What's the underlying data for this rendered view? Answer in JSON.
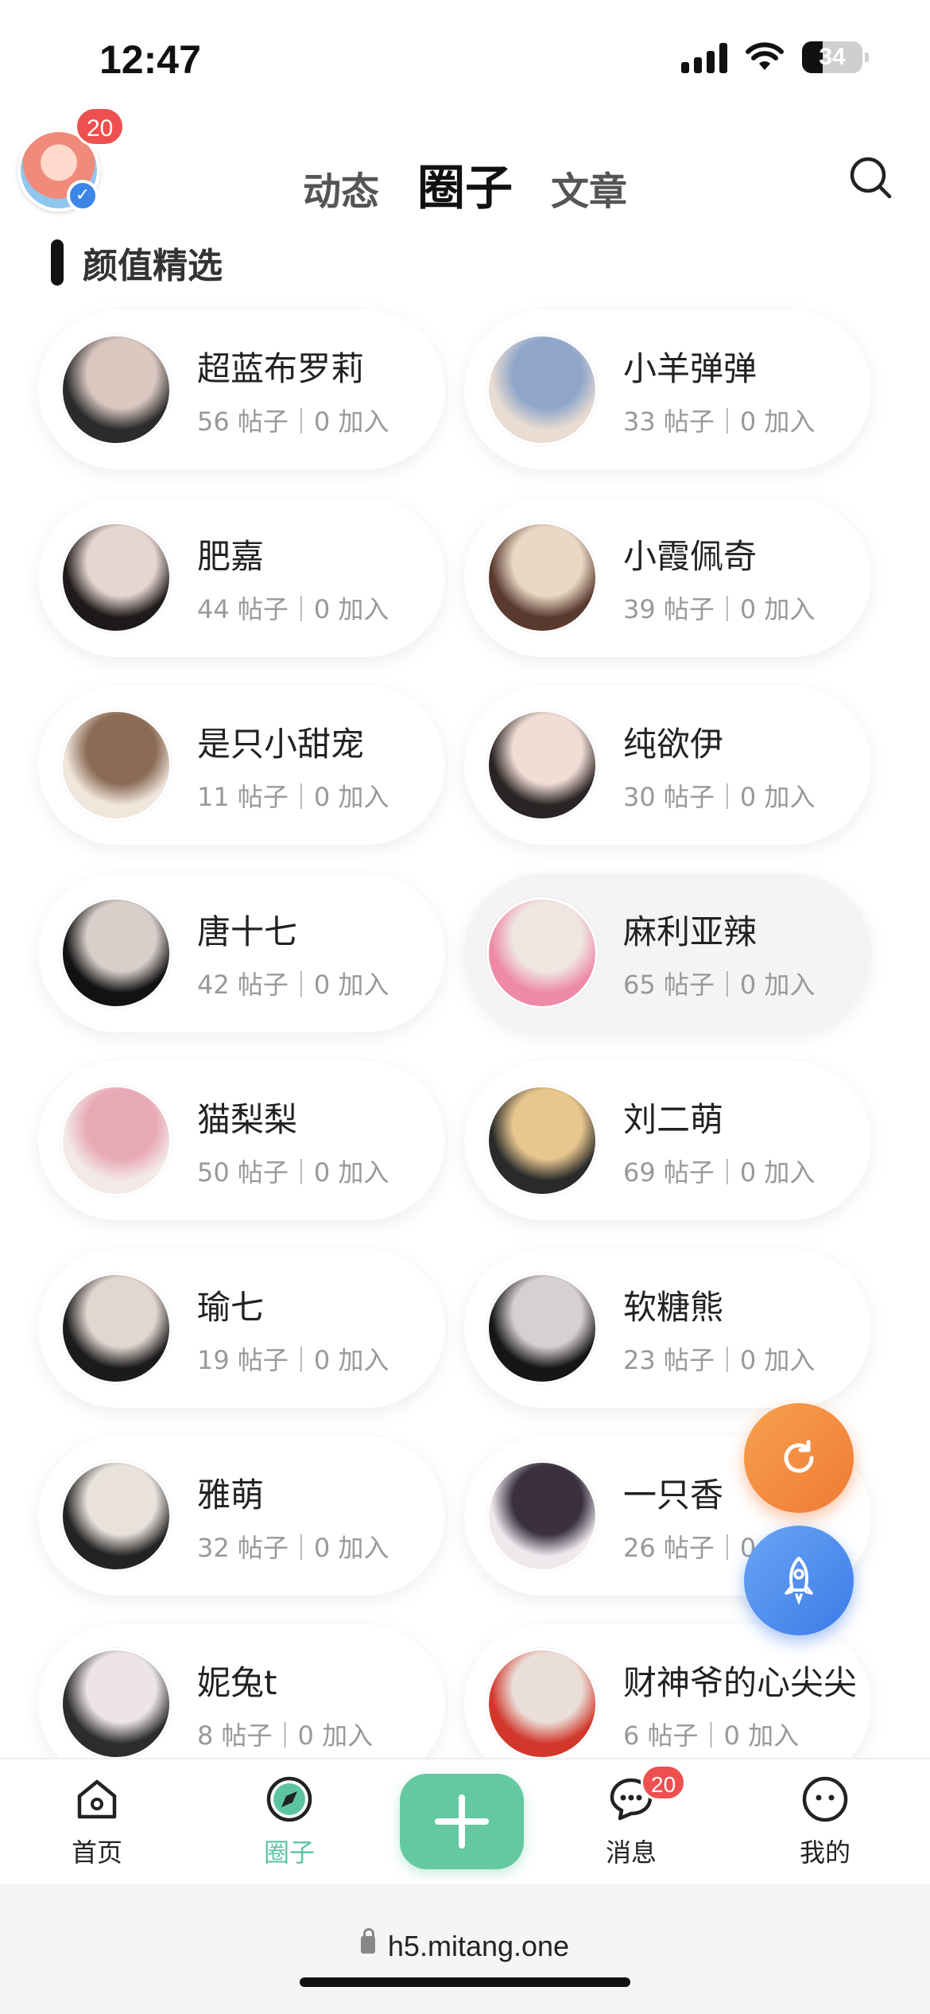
{
  "status_bar": {
    "time": "12:47",
    "battery": "34"
  },
  "header": {
    "notification_count": "20",
    "tabs": [
      {
        "label": "动态",
        "active": false
      },
      {
        "label": "圈子",
        "active": true
      },
      {
        "label": "文章",
        "active": false
      }
    ]
  },
  "section": {
    "title": "颜值精选"
  },
  "circles": [
    {
      "name": "超蓝布罗莉",
      "meta": "56 帖子｜0 加入",
      "colors": [
        "#2b2b2b",
        "#d9c7c0"
      ]
    },
    {
      "name": "小羊弹弹",
      "meta": "33 帖子｜0 加入",
      "colors": [
        "#e9dcd2",
        "#8fa6c9"
      ]
    },
    {
      "name": "肥嘉",
      "meta": "44 帖子｜0 加入",
      "colors": [
        "#1f1a1a",
        "#e6d6d0"
      ]
    },
    {
      "name": "小霞佩奇",
      "meta": "39 帖子｜0 加入",
      "colors": [
        "#5a3a2e",
        "#e9d8c6"
      ]
    },
    {
      "name": "是只小甜宠",
      "meta": "11 帖子｜0 加入",
      "colors": [
        "#f0e6dc",
        "#8b6b55"
      ]
    },
    {
      "name": "纯欲伊",
      "meta": "30 帖子｜0 加入",
      "colors": [
        "#2a2424",
        "#f2ddd6"
      ]
    },
    {
      "name": "唐十七",
      "meta": "42 帖子｜0 加入",
      "colors": [
        "#121212",
        "#d8cfcb"
      ]
    },
    {
      "name": "麻利亚辣",
      "meta": "65 帖子｜0 加入",
      "colors": [
        "#ee8aa8",
        "#efe6e1"
      ]
    },
    {
      "name": "猫梨梨",
      "meta": "50 帖子｜0 加入",
      "colors": [
        "#f3e9e6",
        "#e8a9b6"
      ]
    },
    {
      "name": "刘二萌",
      "meta": "69 帖子｜0 加入",
      "colors": [
        "#2a2a2a",
        "#e8c78f"
      ]
    },
    {
      "name": "瑜七",
      "meta": "19 帖子｜0 加入",
      "colors": [
        "#1b1b1b",
        "#e2d6d1"
      ]
    },
    {
      "name": "软糖熊",
      "meta": "23 帖子｜0 加入",
      "colors": [
        "#161616",
        "#d6cfd4"
      ]
    },
    {
      "name": "雅萌",
      "meta": "32 帖子｜0 加入",
      "colors": [
        "#232323",
        "#e9e2dc"
      ]
    },
    {
      "name": "一只香",
      "meta": "26 帖子｜0 加入",
      "colors": [
        "#efe9ee",
        "#3a3040"
      ]
    },
    {
      "name": "妮兔t",
      "meta": "8 帖子｜0 加入",
      "colors": [
        "#2c2c2c",
        "#ece4e8"
      ]
    },
    {
      "name": "财神爷的心尖尖",
      "meta": "6 帖子｜0 加入",
      "colors": [
        "#d2372c",
        "#eadfd8"
      ]
    }
  ],
  "bottom_nav": {
    "items": [
      {
        "label": "首页",
        "icon": "home-icon"
      },
      {
        "label": "圈子",
        "icon": "compass-icon"
      },
      {
        "label": "消息",
        "icon": "chat-icon",
        "badge": "20"
      },
      {
        "label": "我的",
        "icon": "face-icon"
      }
    ],
    "active": "圈子",
    "add_icon": "plus-icon"
  },
  "browser": {
    "url": "h5.mitang.one"
  },
  "colors": {
    "accent": "#64c8a1",
    "badge": "#ee4f4f",
    "refresh": "#f07a35",
    "rocket": "#3c7be8"
  }
}
